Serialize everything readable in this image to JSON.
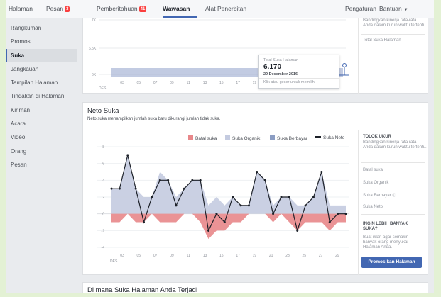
{
  "nav": {
    "items": [
      {
        "label": "Halaman"
      },
      {
        "label": "Pesan",
        "badge": "3"
      },
      {
        "label": "Pemberitahuan",
        "badge": "41"
      },
      {
        "label": "Wawasan"
      },
      {
        "label": "Alat Penerbitan"
      }
    ],
    "settings": "Pengaturan",
    "help": "Bantuan"
  },
  "sidebar": {
    "items": [
      "Rangkuman",
      "Promosi",
      "Suka",
      "Jangkauan",
      "Tampilan Halaman",
      "Tindakan di Halaman",
      "Kiriman",
      "Acara",
      "Video",
      "Orang",
      "Pesan"
    ]
  },
  "total_card": {
    "right_text": "Bandingkan kinerja rata-rata Anda dalam kurun waktu tertentu.",
    "right_link": "Total Suka Halaman",
    "tooltip": {
      "label": "Total Suka Halaman",
      "value": "6.170",
      "date": "29 Desember 2016",
      "hint": "Klik atau geser untuk memilih"
    },
    "chart_data": {
      "type": "area",
      "title": "Total Suka Halaman",
      "y_ticks": [
        "7K",
        "6.5K",
        "6K"
      ],
      "x_ticks": [
        "03",
        "05",
        "07",
        "09",
        "11",
        "13",
        "15",
        "17",
        "19",
        "21",
        "23",
        "25",
        "27",
        "29"
      ],
      "x_sublabel": "DES",
      "note": "Flat series near 6.1K–6.17K across December"
    }
  },
  "net_card": {
    "title": "Neto Suka",
    "subtitle": "Neto suka menampilkan jumlah suka baru dikurangi jumlah tidak suka.",
    "legend": [
      "Batal suka",
      "Suka Organik",
      "Suka Berbayar",
      "Suka Neto"
    ],
    "colors": {
      "unlike": "#e8878a",
      "organic": "#c4cbe0",
      "paid": "#8b9dc3",
      "net": "#1d2129"
    },
    "chart_data": {
      "type": "line",
      "title": "Neto Suka",
      "ylim": [
        -4,
        8
      ],
      "y_ticks": [
        8,
        6,
        4,
        2,
        0,
        -2,
        -4
      ],
      "x_ticks": [
        "03",
        "05",
        "07",
        "09",
        "11",
        "13",
        "15",
        "17",
        "19",
        "21",
        "23",
        "25",
        "27",
        "29"
      ],
      "x_sublabel": "DES",
      "x": [
        1,
        2,
        3,
        4,
        5,
        6,
        7,
        8,
        9,
        10,
        11,
        12,
        13,
        14,
        15,
        16,
        17,
        18,
        19,
        20,
        21,
        22,
        23,
        24,
        25,
        26,
        27,
        28,
        29,
        30
      ],
      "series": [
        {
          "name": "Suka Neto",
          "values": [
            3,
            3,
            7,
            3,
            -1,
            2,
            4,
            4,
            1,
            3,
            4,
            4,
            -2,
            0,
            -1,
            2,
            1,
            1,
            5,
            4,
            0,
            2,
            2,
            -2,
            1,
            2,
            5,
            -1,
            0,
            0
          ]
        },
        {
          "name": "Suka Organik",
          "values": [
            3,
            3,
            7,
            3,
            2,
            2,
            5,
            4,
            2,
            3,
            4,
            4,
            1,
            2,
            1,
            2,
            1,
            1,
            5,
            4,
            1,
            2,
            2,
            1,
            1,
            2,
            5,
            1,
            1,
            1
          ]
        },
        {
          "name": "Batal suka",
          "values": [
            -1,
            -1,
            0,
            -1,
            -1,
            0,
            -1,
            -1,
            -1,
            0,
            0,
            -1,
            -3,
            -2,
            -2,
            -1,
            -1,
            0,
            0,
            0,
            -1,
            0,
            -1,
            -2,
            -1,
            -1,
            -1,
            -2,
            -1,
            -1
          ]
        }
      ]
    },
    "right": {
      "heading": "TOLOK UKUR",
      "text": "Bandingkan kinerja rata-rata Anda dalam kurun waktu tertentu.",
      "links": [
        "Batal suka",
        "Suka Organik",
        "Suka Berbayar",
        "Suka Neto"
      ],
      "promo_heading": "INGIN LEBIH BANYAK SUKA?",
      "promo_text": "Buat iklan agar semakin banyak orang menyukai Halaman Anda.",
      "promo_button": "Promosikan Halaman"
    }
  },
  "where_card": {
    "title": "Di mana Suka Halaman Anda Terjadi"
  }
}
